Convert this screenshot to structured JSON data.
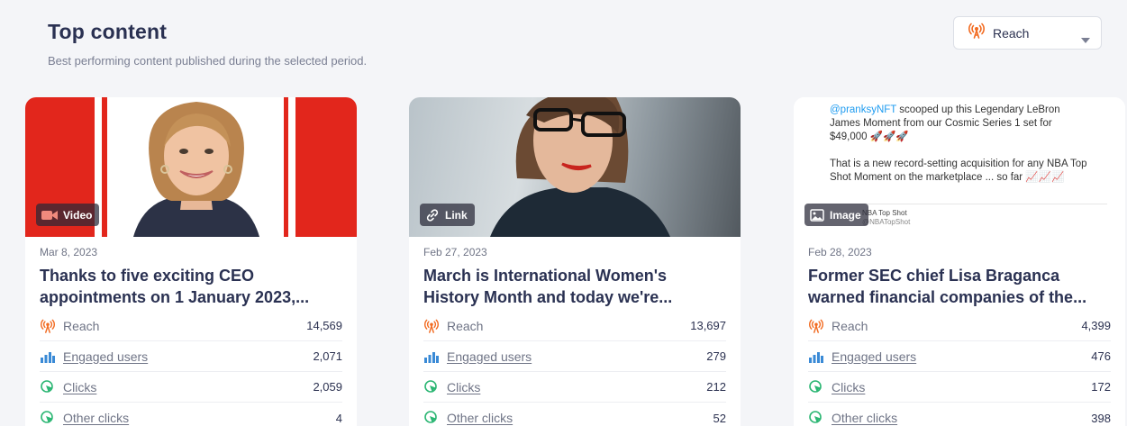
{
  "header": {
    "title": "Top content",
    "subtitle": "Best performing content published during the selected period."
  },
  "metric_select": {
    "selected": "Reach",
    "icon": "broadcast-icon"
  },
  "colors": {
    "accent_orange": "#f26b21",
    "accent_blue": "#3a8ad6",
    "accent_green": "#2bb673",
    "title_text": "#2a3152"
  },
  "cards": [
    {
      "type": "Video",
      "type_icon": "video-camera-icon",
      "date": "Mar 8, 2023",
      "title_line1": "Thanks to five exciting CEO",
      "title_line2": "appointments on 1 January 2023,...",
      "stats": [
        {
          "label": "Reach",
          "value": "14,569"
        },
        {
          "label": "Engaged users",
          "value": "2,071"
        },
        {
          "label": "Clicks",
          "value": "2,059"
        },
        {
          "label": "Other clicks",
          "value": "4"
        }
      ]
    },
    {
      "type": "Link",
      "type_icon": "link-icon",
      "date": "Feb 27, 2023",
      "title_line1": "March is International Women's",
      "title_line2": "History Month and today we're...",
      "stats": [
        {
          "label": "Reach",
          "value": "13,697"
        },
        {
          "label": "Engaged users",
          "value": "279"
        },
        {
          "label": "Clicks",
          "value": "212"
        },
        {
          "label": "Other clicks",
          "value": "52"
        }
      ]
    },
    {
      "type": "Image",
      "type_icon": "image-icon",
      "date": "Feb 28, 2023",
      "title_line1": "Former SEC chief Lisa Braganca",
      "title_line2": "warned financial companies of the...",
      "tweet": {
        "handle": "@pranksyNFT",
        "text1": " scooped up this Legendary LeBron James Moment from our Cosmic Series 1 set for $49,000 🚀🚀🚀",
        "text2": "That is a new record-setting acquisition for any NBA Top Shot Moment on the marketplace ... so far 📈📈📈",
        "embed_name": "NBA Top Shot",
        "embed_handle": "@NBATopShot"
      },
      "stats": [
        {
          "label": "Reach",
          "value": "4,399"
        },
        {
          "label": "Engaged users",
          "value": "476"
        },
        {
          "label": "Clicks",
          "value": "172"
        },
        {
          "label": "Other clicks",
          "value": "398"
        }
      ]
    }
  ]
}
